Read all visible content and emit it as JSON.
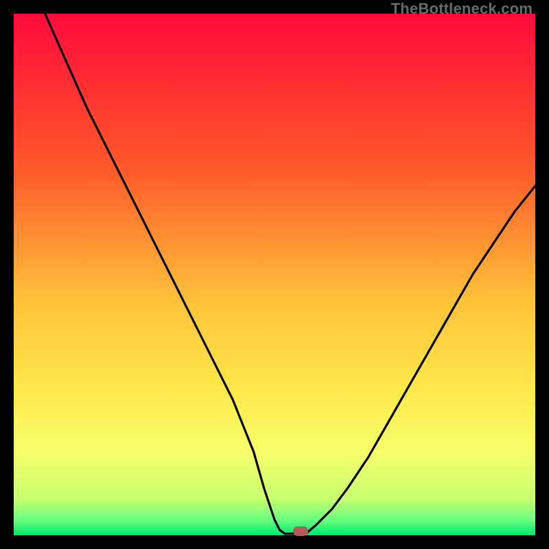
{
  "watermark": "TheBottleneck.com",
  "colors": {
    "bg": "#000000",
    "gradient_top": "#ff0a3a",
    "gradient_mid1": "#ff7a2a",
    "gradient_mid2": "#ffd83a",
    "gradient_mid3": "#f7ff6a",
    "gradient_bottom": "#00e76b",
    "curve": "#000000",
    "marker": "#b35a5a"
  },
  "chart_data": {
    "type": "line",
    "title": "",
    "xlabel": "",
    "ylabel": "",
    "xlim": [
      0,
      100
    ],
    "ylim": [
      0,
      100
    ],
    "gradient_stops": [
      {
        "offset": 0.0,
        "color": "#ff0a3a"
      },
      {
        "offset": 0.3,
        "color": "#ff5a2a"
      },
      {
        "offset": 0.55,
        "color": "#ffc23a"
      },
      {
        "offset": 0.72,
        "color": "#ffe84a"
      },
      {
        "offset": 0.84,
        "color": "#f7ff6a"
      },
      {
        "offset": 0.93,
        "color": "#c8ff70"
      },
      {
        "offset": 0.97,
        "color": "#6aff80"
      },
      {
        "offset": 1.0,
        "color": "#00e76b"
      }
    ],
    "series": [
      {
        "name": "left-branch",
        "x": [
          6,
          10,
          14,
          18,
          22,
          26,
          30,
          34,
          38,
          42,
          46,
          48,
          50,
          51,
          52
        ],
        "y": [
          100,
          91,
          82,
          74,
          66,
          58,
          50,
          42,
          34,
          26,
          16,
          9,
          3,
          1,
          0.3
        ]
      },
      {
        "name": "flat-segment",
        "x": [
          52,
          56
        ],
        "y": [
          0.3,
          0.3
        ]
      },
      {
        "name": "right-branch",
        "x": [
          56,
          58,
          61,
          64,
          68,
          72,
          76,
          80,
          84,
          88,
          92,
          96,
          100
        ],
        "y": [
          0.3,
          2,
          5,
          9,
          15,
          22,
          29,
          36,
          43,
          50,
          56,
          62,
          67
        ]
      }
    ],
    "marker": {
      "x": 55,
      "y": 0.8
    },
    "annotations": []
  }
}
